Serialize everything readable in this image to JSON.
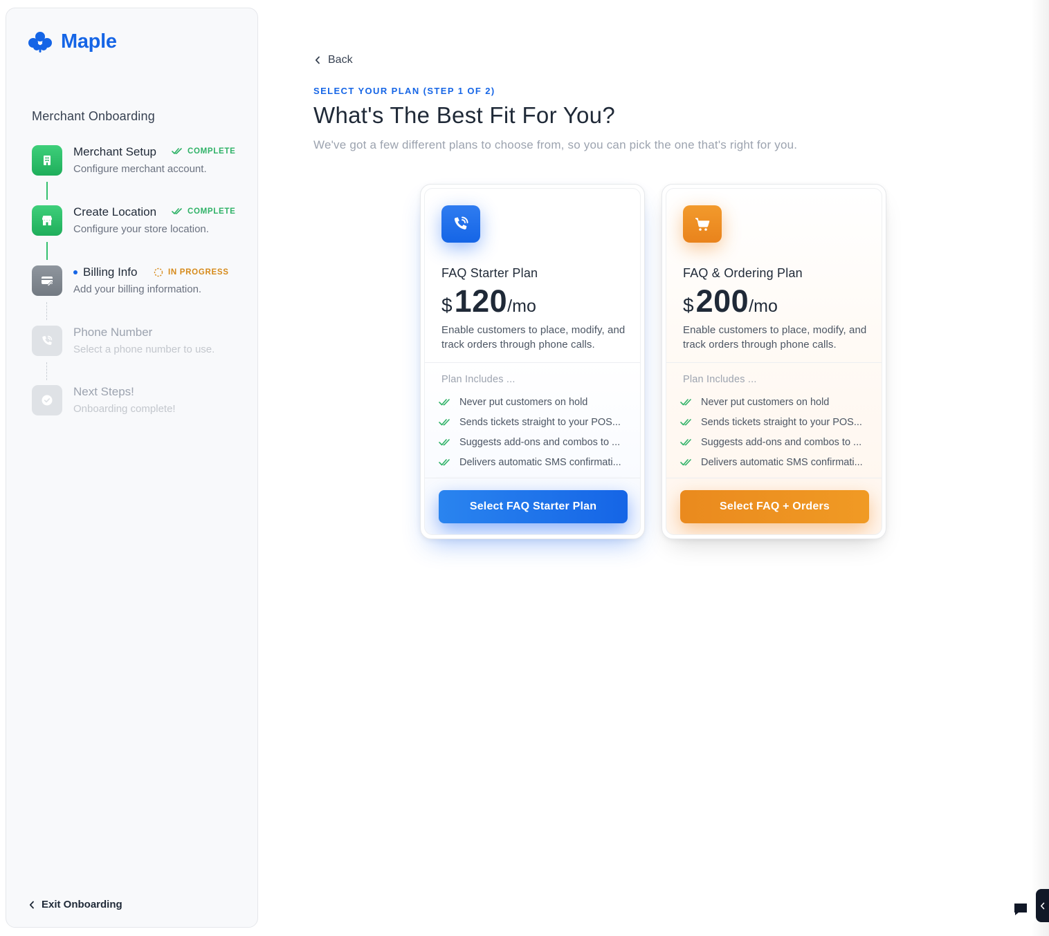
{
  "brand": {
    "name": "Maple",
    "color": "#1565e6",
    "icon": "maple-leaf-icon"
  },
  "sidebar": {
    "title": "Merchant Onboarding",
    "steps": [
      {
        "name": "Merchant Setup",
        "desc": "Configure merchant account.",
        "status": "COMPLETE",
        "icon": "building-icon",
        "state": "complete"
      },
      {
        "name": "Create Location",
        "desc": "Configure your store location.",
        "status": "COMPLETE",
        "icon": "storefront-icon",
        "state": "complete"
      },
      {
        "name": "Billing Info",
        "desc": "Add your billing information.",
        "status": "IN PROGRESS",
        "icon": "billing-card-icon",
        "state": "in-progress"
      },
      {
        "name": "Phone Number",
        "desc": "Select a phone number to use.",
        "status": "",
        "icon": "phone-call-icon",
        "state": "pending"
      },
      {
        "name": "Next Steps!",
        "desc": "Onboarding complete!",
        "status": "",
        "icon": "check-circle-icon",
        "state": "pending"
      }
    ],
    "exit_label": "Exit Onboarding"
  },
  "main": {
    "back_label": "Back",
    "eyebrow": "SELECT YOUR PLAN (STEP 1 OF 2)",
    "headline": "What's The Best Fit For You?",
    "subline": "We've got a few different plans to choose from, so you can pick the one that's right for you."
  },
  "plans": [
    {
      "name": "FAQ Starter Plan",
      "currency": "$",
      "amount": "120",
      "period": "/mo",
      "description": "Enable customers to place, modify, and track orders through phone calls.",
      "includes_label": "Plan Includes ...",
      "features": [
        "Never put customers on hold",
        "Sends tickets straight to your POS...",
        "Suggests add-ons and combos to ...",
        "Delivers automatic SMS confirmati..."
      ],
      "cta": "Select FAQ Starter Plan",
      "icon": "phone-call-icon",
      "accent": "#1565e6"
    },
    {
      "name": "FAQ & Ordering Plan",
      "currency": "$",
      "amount": "200",
      "period": "/mo",
      "description": "Enable customers to place, modify, and track orders through phone calls.",
      "includes_label": "Plan Includes ...",
      "features": [
        "Never put customers on hold",
        "Sends tickets straight to your POS...",
        "Suggests add-ons and combos to ...",
        "Delivers automatic SMS confirmati..."
      ],
      "cta": "Select FAQ + Orders",
      "icon": "shopping-cart-icon",
      "accent": "#ee8f20"
    }
  ],
  "colors": {
    "complete": "#2fb267",
    "in_progress": "#d68a1a",
    "muted_text": "#9ca3af"
  }
}
